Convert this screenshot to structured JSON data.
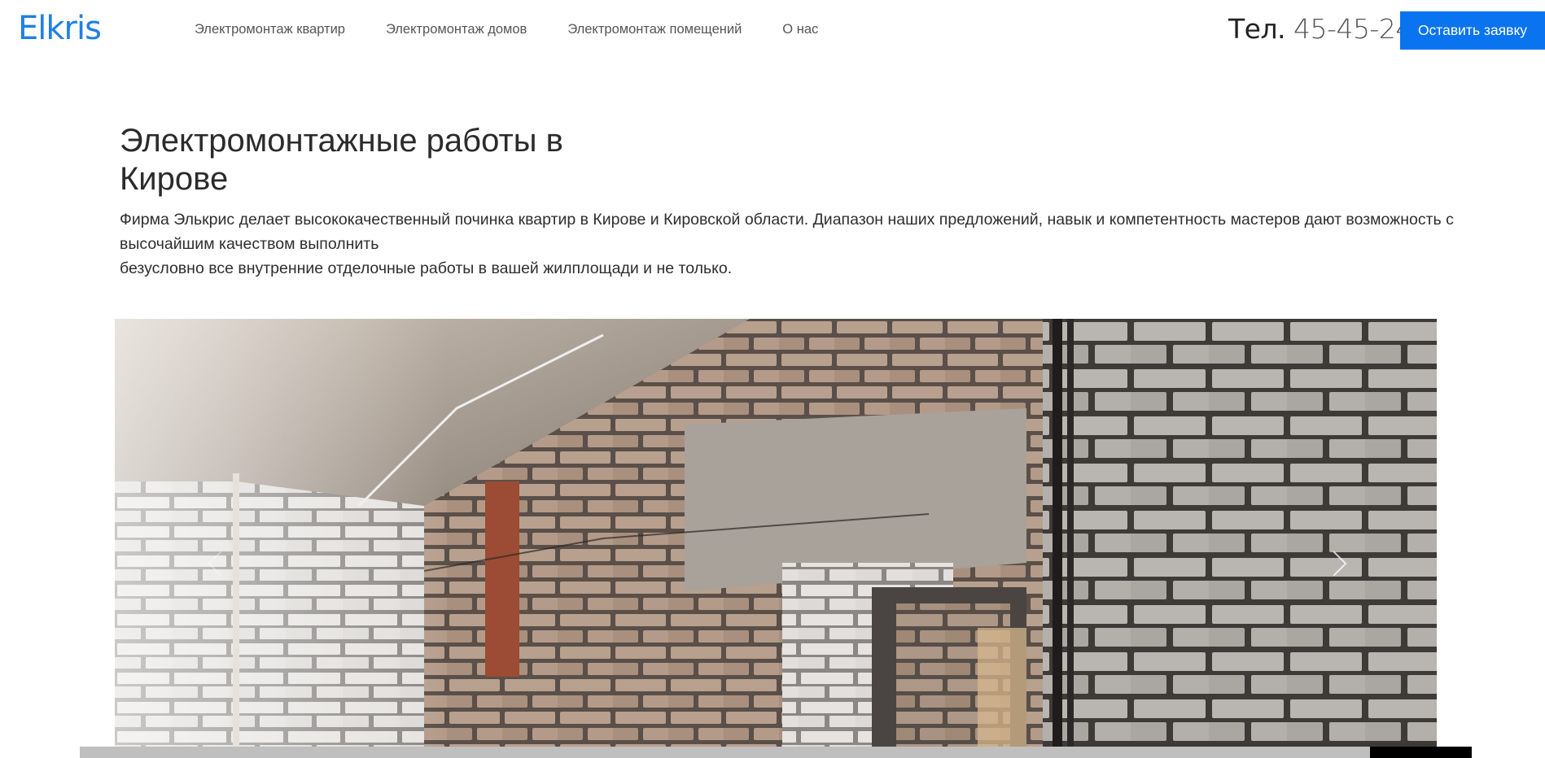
{
  "header": {
    "logo": "Elkris",
    "nav": [
      {
        "label": "Электромонтаж квартир"
      },
      {
        "label": "Электромонтаж домов"
      },
      {
        "label": "Электромонтаж помещений"
      },
      {
        "label": "О нас"
      }
    ],
    "phone_label": "Тел.",
    "phone_number": "45-45-24",
    "cta_label": "Оставить заявку"
  },
  "hero": {
    "title_line1": "Электромонтажные работы в",
    "title_line2": "Кирове",
    "lead_line1": "Фирма Элькрис делает высококачественный починка квартир в Кирове и Кировской области. Диапазон наших предложений, навык и компетентность мастеров дают возможность с",
    "lead_line2": "высочайшим качеством выполнить",
    "lead_line3": "безусловно все внутренние отделочные работы в вашей жилплощади и не только."
  },
  "slider": {
    "image": "brick-wall-electrical-wiring-photo",
    "prev_icon": "chevron-left-icon",
    "next_icon": "chevron-right-icon",
    "progress": 0.0
  },
  "colors": {
    "accent": "#0a73ef",
    "logo": "#1f7fe6"
  }
}
